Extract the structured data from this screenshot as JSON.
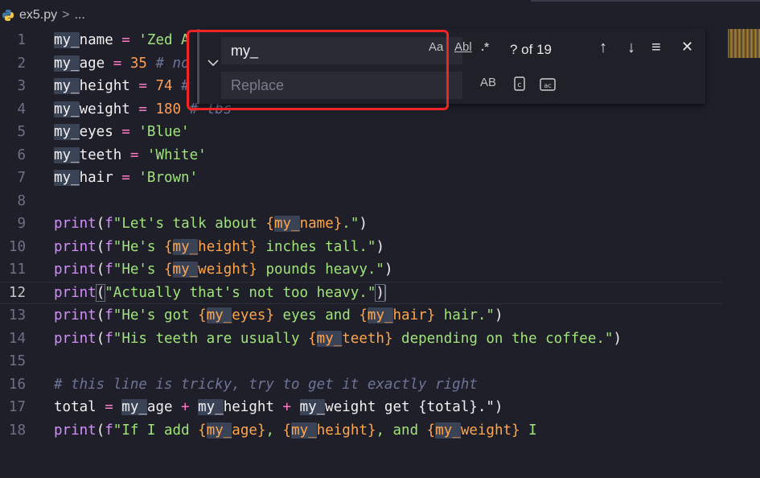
{
  "breadcrumb": {
    "file": "ex5.py",
    "separator": ">",
    "more": "..."
  },
  "find_widget": {
    "toggle_icon": "chevron-down",
    "find_value": "my_",
    "match_case": "Aa",
    "whole_word": "Abl",
    "regex": ".*",
    "count": "? of 19",
    "prev_icon": "↑",
    "next_icon": "↓",
    "selection_icon": "≡",
    "close_icon": "✕",
    "replace_placeholder": "Replace",
    "preserve_case": "AB"
  },
  "editor": {
    "lines": [
      {
        "n": "1"
      },
      {
        "n": "2"
      },
      {
        "n": "3"
      },
      {
        "n": "4"
      },
      {
        "n": "5"
      },
      {
        "n": "6"
      },
      {
        "n": "7"
      },
      {
        "n": "8"
      },
      {
        "n": "9"
      },
      {
        "n": "10"
      },
      {
        "n": "11"
      },
      {
        "n": "12"
      },
      {
        "n": "13"
      },
      {
        "n": "14"
      },
      {
        "n": "15"
      },
      {
        "n": "16"
      },
      {
        "n": "17"
      },
      {
        "n": "18"
      }
    ],
    "tokens": {
      "my": "my_",
      "name": "name",
      "age": "age",
      "height": "height",
      "weight": "weight",
      "eyes": "eyes",
      "teeth": "teeth",
      "hair": "hair",
      "eq": " = ",
      "l1_str": "'Zed A",
      "l2_num": "35",
      "l2_com": " # no",
      "l3_num": "74",
      "l3_com": " #",
      "l4_num": "180",
      "l4_com": " # lbs",
      "l5_str": "'Blue'",
      "l6_str": "'White'",
      "l7_str": "'Brown'",
      "print": "print",
      "lp": "(",
      "rp": ")",
      "f": "f",
      "ob": "{",
      "cb": "}",
      "l9_a": "\"Let's talk about ",
      "l9_b": ".\"",
      "l10_a": "\"He's ",
      "l10_b": " inches tall.\"",
      "l11_a": "\"He's ",
      "l11_b": " pounds heavy.\"",
      "l12_a": "\"Actually that's not too heavy.\"",
      "l13_a": "\"He's got ",
      "l13_b": " eyes and ",
      "l13_c": " hair.\"",
      "l14_a": "\"His teeth are usually ",
      "l14_b": " depending on the coffee.\"",
      "l16_com": "# this line is tricky, try to get it exactly right",
      "total": "total",
      "plus": " + ",
      "l17_tail": " get {total}.\")",
      "l18_a": "\"If I add ",
      "comma": ", ",
      "and": ", and ",
      "l18_tail": " I"
    }
  }
}
